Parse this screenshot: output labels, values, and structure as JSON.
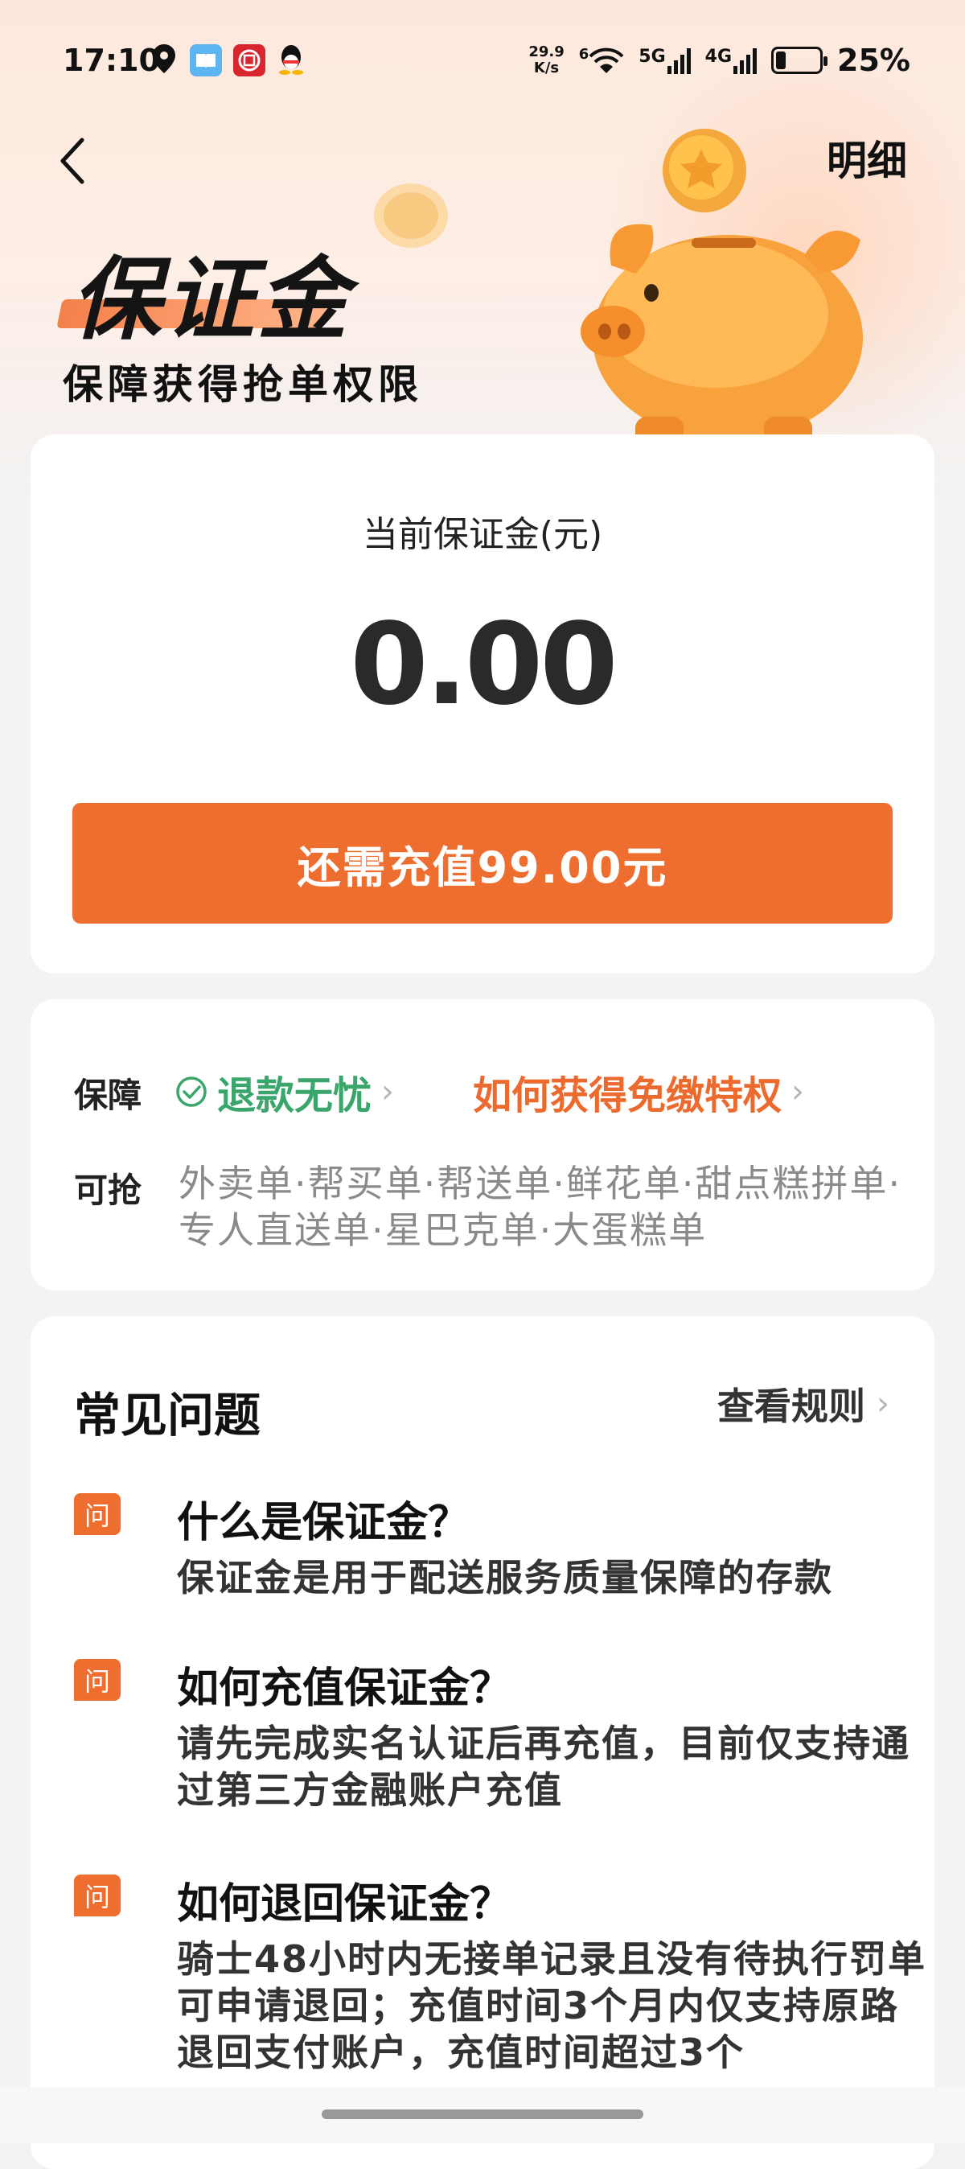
{
  "status_bar": {
    "time": "17:10",
    "speed_value": "29.9",
    "speed_unit": "K/s",
    "wifi_sub": "6",
    "net1": "5G",
    "net2": "4G",
    "battery": "25%",
    "icons": [
      "location-icon",
      "reader-app-icon",
      "bank-app-icon",
      "qq-icon"
    ]
  },
  "header": {
    "detail_label": "明细",
    "title": "保证金",
    "subtitle": "保障获得抢单权限"
  },
  "deposit_card": {
    "label": "当前保证金(元)",
    "amount": "0.00",
    "cta_label": "还需充值99.00元"
  },
  "benefits_card": {
    "guarantee_label": "保障",
    "guarantee_link": "退款无忧",
    "privilege_link": "如何获得免缴特权",
    "grab_label": "可抢",
    "grab_types": "外卖单·帮买单·帮送单·鲜花单·甜点糕拼单·专人直送单·星巴克单·大蛋糕单"
  },
  "faq": {
    "title": "常见问题",
    "rules_link": "查看规则",
    "badge": "问",
    "items": [
      {
        "q": "什么是保证金？",
        "a": "保证金是用于配送服务质量保障的存款"
      },
      {
        "q": "如何充值保证金？",
        "a": "请先完成实名认证后再充值，目前仅支持通过第三方金融账户充值"
      },
      {
        "q": "如何退回保证金？",
        "a": "骑士48小时内无接单记录且没有待执行罚单可申请退回；充值时间3个月内仅支持原路退回支付账户，充值时间超过3个"
      }
    ]
  },
  "colors": {
    "accent": "#ee6e30",
    "green": "#3aa66c",
    "card_bg": "#ffffff",
    "page_bg": "#f3f3f3"
  }
}
